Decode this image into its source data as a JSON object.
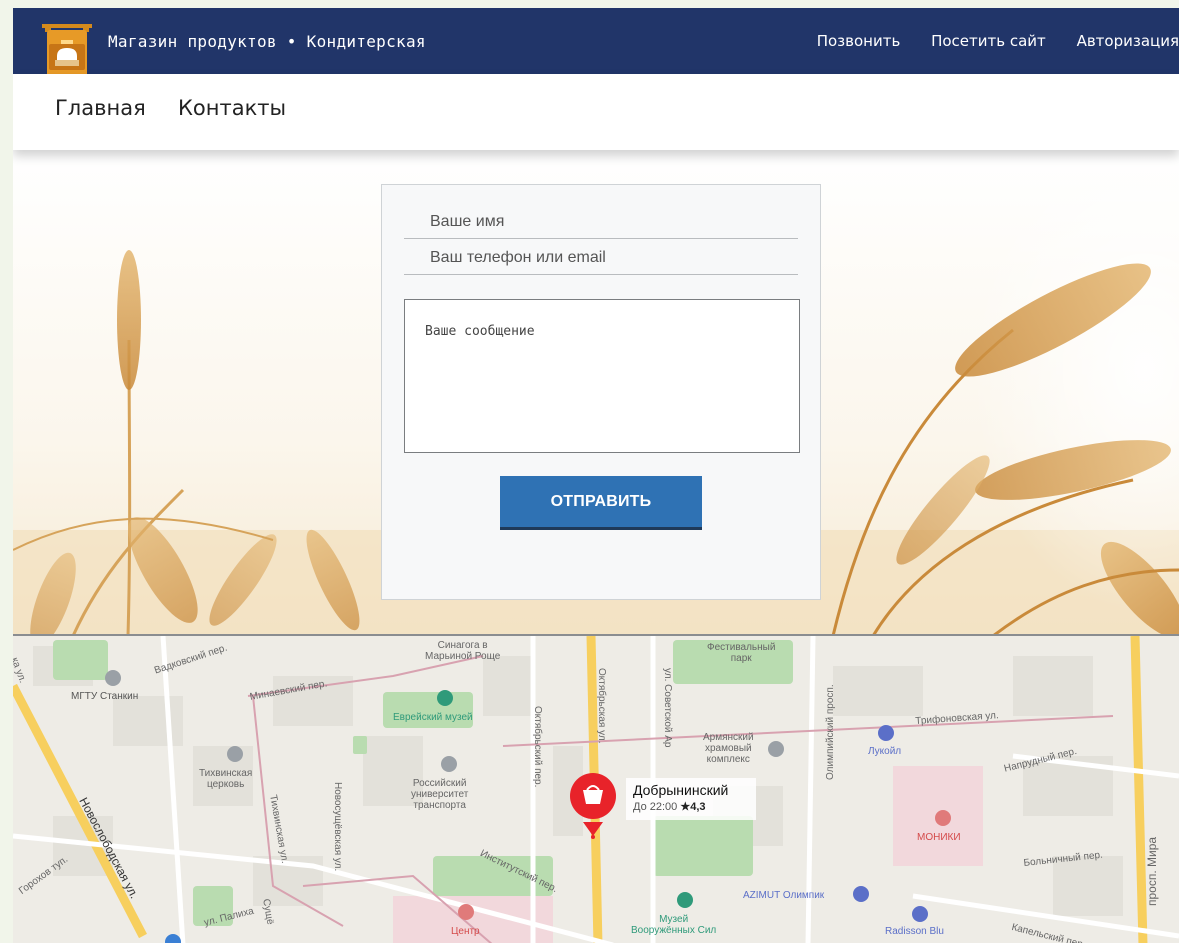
{
  "header": {
    "brand": "Магазин продуктов • Кондитерская",
    "links": [
      "Позвонить",
      "Посетить сайт",
      "Авторизация"
    ]
  },
  "nav": {
    "items": [
      "Главная",
      "Контакты"
    ]
  },
  "form": {
    "name_placeholder": "Ваше имя",
    "contact_placeholder": "Ваш телефон или email",
    "message_placeholder": "Ваше сообщение",
    "submit_label": "ОТПРАВИТЬ"
  },
  "map": {
    "labels": {
      "sinagoga": "Синагога в\nМарьиной Роще",
      "festival_park": "Фестивальный\nпарк",
      "vadkovsky": "Вадковский пер.",
      "mgtu": "МГТУ Станкин",
      "minaevsky": "Минаевский пер.",
      "jewish_museum": "Еврейский музей",
      "oktyabrskaya": "Октябрьская ул.",
      "sovetskoy_armii": "ул. Советской Ар",
      "olimpiysky": "Олимпийский просп.",
      "armenian": "Армянский\nхрамовый\nкомплекс",
      "lukoil": "Лукойл",
      "trifonovskaya": "Трифоновская ул.",
      "napudny": "Напрудный пер.",
      "tikhvin_church": "Тихвинская\nцерковь",
      "university": "Российский\nуниверситет\nтранспорта",
      "oktyabrsky_per": "Октябрьский пер.",
      "novosushchevskaya": "Новосущёвская ул.",
      "tikhvinskaya": "Тихвинская ул.",
      "moniki": "МОНИКИ",
      "bolnichny": "Больничный пер.",
      "prosp_mira": "просп. Мира",
      "novoslobodskaya": "Новослободская ул.",
      "institutsky": "Институтский пер.",
      "azimut": "AZIMUT Олимпик",
      "museum_arms": "Музей\nВооружённых Сил",
      "radisson": "Radisson Blu",
      "tsentr": "Центр",
      "palikha": "ул. Палиха",
      "sushch": "Сущё",
      "gorokhov": "Горохов туп.",
      "kapelsky": "Капельский пер.",
      "yanka": "ка ул."
    },
    "pin": {
      "title": "Добрынинский",
      "hours": "До 22:00",
      "rating": "★4,3",
      "color": "#e8232a"
    }
  },
  "colors": {
    "header_bg": "#213569",
    "button_bg": "#2f72b4"
  }
}
